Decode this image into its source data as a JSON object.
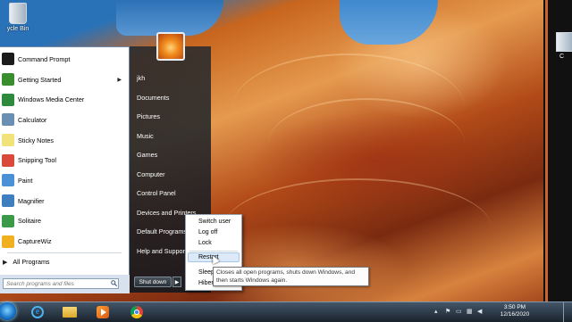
{
  "desktop": {
    "recycle_bin_label": "ycle Bin"
  },
  "start_menu": {
    "programs": [
      {
        "label": "Command Prompt",
        "icon": "command-prompt-icon",
        "color": "#1b1b1b"
      },
      {
        "label": "Getting Started",
        "icon": "getting-started-icon",
        "color": "#3a8d2f",
        "has_submenu": true
      },
      {
        "label": "Windows Media Center",
        "icon": "media-center-icon",
        "color": "#2e8b3e"
      },
      {
        "label": "Calculator",
        "icon": "calculator-icon",
        "color": "#6a8fb3"
      },
      {
        "label": "Sticky Notes",
        "icon": "sticky-notes-icon",
        "color": "#f2e27a"
      },
      {
        "label": "Snipping Tool",
        "icon": "snipping-tool-icon",
        "color": "#d94a3a"
      },
      {
        "label": "Paint",
        "icon": "paint-icon",
        "color": "#4a90d6"
      },
      {
        "label": "Magnifier",
        "icon": "magnifier-icon",
        "color": "#3f7fc0"
      },
      {
        "label": "Solitaire",
        "icon": "solitaire-icon",
        "color": "#3b9a4a"
      },
      {
        "label": "CaptureWiz",
        "icon": "capturewiz-icon",
        "color": "#f0b020"
      }
    ],
    "all_programs": "All Programs",
    "search_placeholder": "Search programs and files",
    "places": [
      "jkh",
      "Documents",
      "Pictures",
      "Music",
      "Games",
      "Computer",
      "Control Panel",
      "Devices and Printers",
      "Default Programs",
      "Help and Support"
    ],
    "shutdown_label": "Shut down"
  },
  "shutdown_menu": {
    "options": [
      "Switch user",
      "Log off",
      "Lock",
      "Restart",
      "Sleep",
      "Hibernate"
    ],
    "highlighted": "Restart",
    "tooltip": "Closes all open programs, shuts down Windows, and then starts Windows again."
  },
  "taskbar": {
    "time": "3:50 PM",
    "date": "12/16/2020",
    "pinned": [
      "internet-explorer-icon",
      "folder-icon",
      "media-player-icon",
      "chrome-icon"
    ]
  }
}
